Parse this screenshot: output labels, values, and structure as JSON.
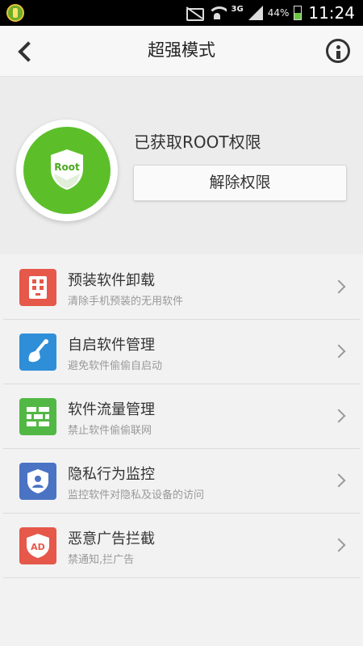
{
  "status_bar": {
    "network": "3G",
    "battery": "44%",
    "time": "11:24"
  },
  "header": {
    "title": "超强模式"
  },
  "root_panel": {
    "badge_text": "Root",
    "status": "已获取ROOT权限",
    "release_button": "解除权限"
  },
  "menu": [
    {
      "title": "预装软件卸载",
      "subtitle": "清除手机预装的无用软件",
      "icon": "preinstalled-apps-icon",
      "color": "#e5584a"
    },
    {
      "title": "自启软件管理",
      "subtitle": "避免软件偷偷自启动",
      "icon": "shovel-icon",
      "color": "#2f8ed8"
    },
    {
      "title": "软件流量管理",
      "subtitle": "禁止软件偷偷联网",
      "icon": "firewall-icon",
      "color": "#52b845"
    },
    {
      "title": "隐私行为监控",
      "subtitle": "监控软件对隐私及设备的访问",
      "icon": "privacy-shield-icon",
      "color": "#4a73c4"
    },
    {
      "title": "恶意广告拦截",
      "subtitle": "禁通知,拦广告",
      "icon": "ad-block-icon",
      "color": "#e5584a"
    }
  ]
}
